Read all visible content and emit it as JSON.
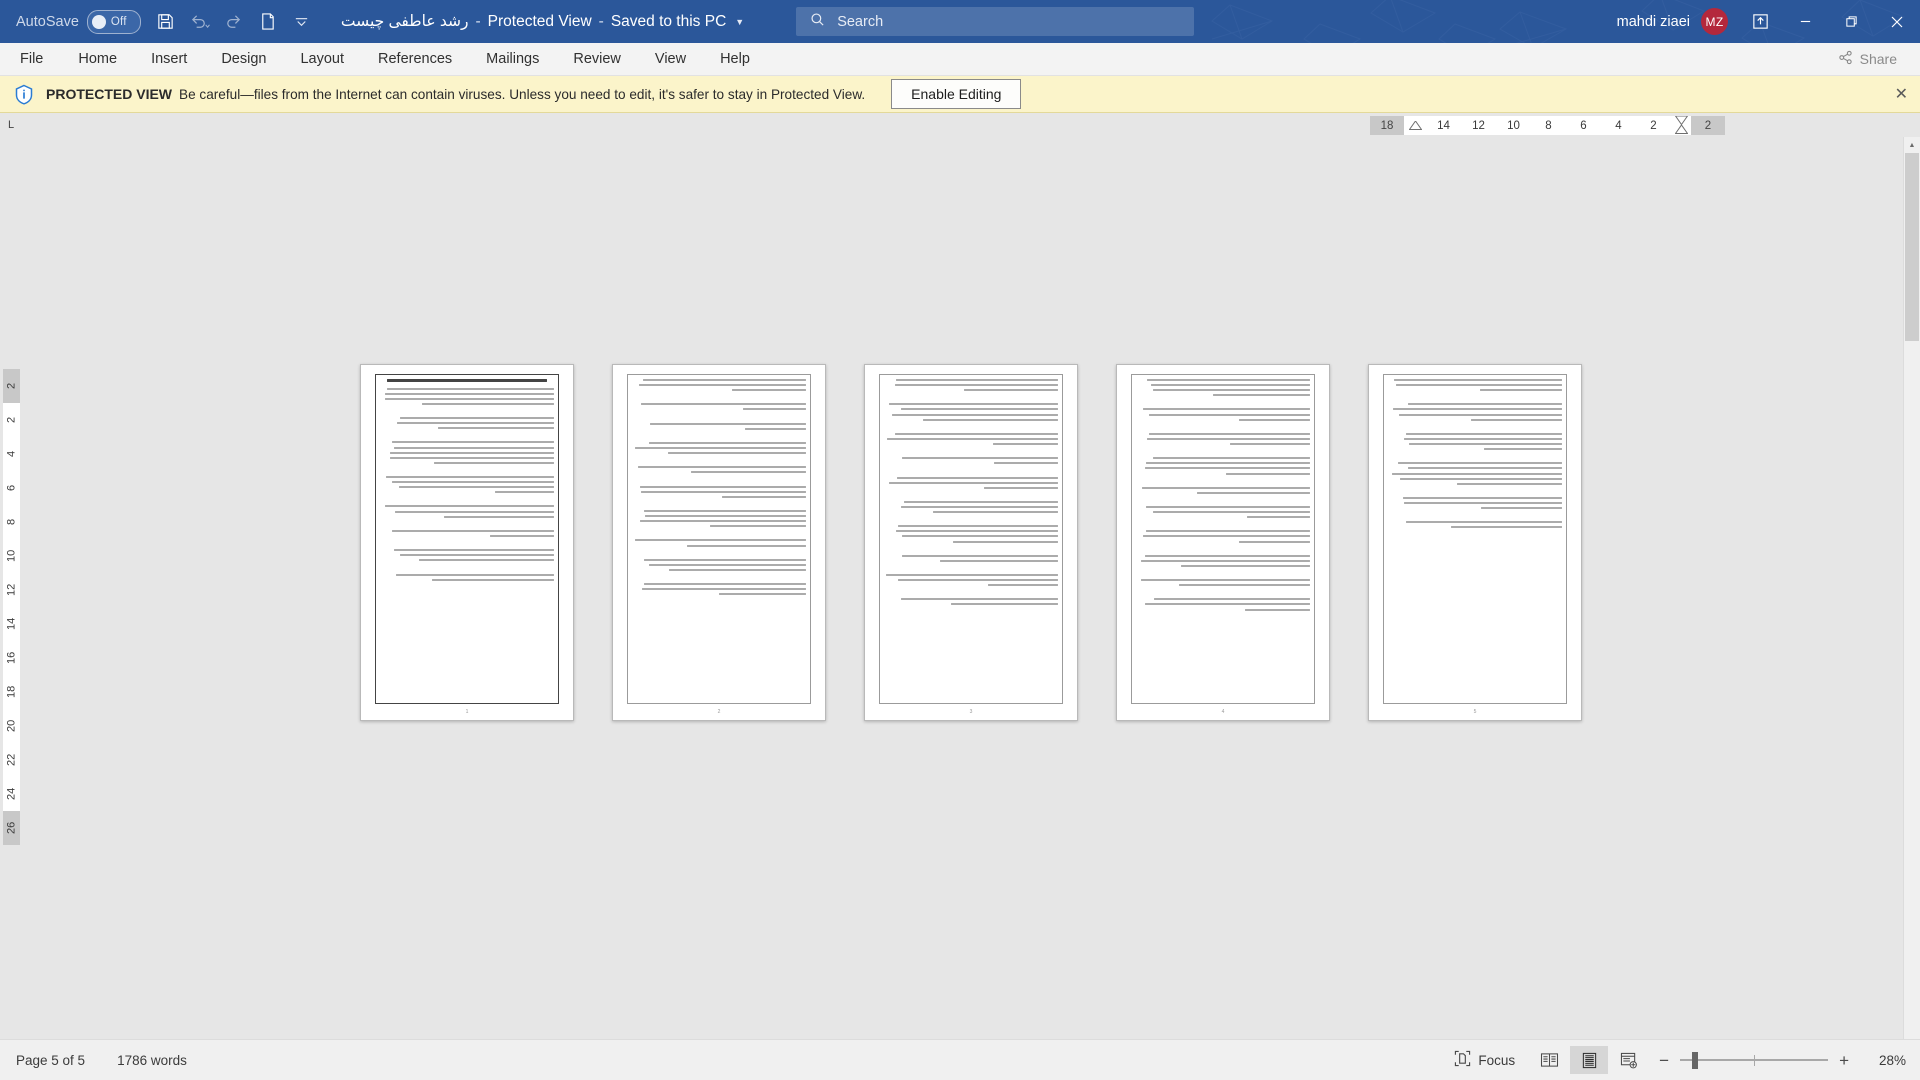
{
  "titlebar": {
    "autosave_label": "AutoSave",
    "autosave_state": "Off",
    "quick_access": [
      {
        "name": "save-icon",
        "label": "Save"
      },
      {
        "name": "undo-icon",
        "label": "Undo"
      },
      {
        "name": "redo-icon",
        "label": "Redo"
      },
      {
        "name": "new-document-icon",
        "label": "New"
      },
      {
        "name": "customize-quick-access-icon",
        "label": "Customize Quick Access Toolbar"
      }
    ],
    "document_title": "رشد عاطفی چیست",
    "protected_view_tag": "Protected View",
    "save_state": "Saved to this PC",
    "title_dropdown_icon": "chevron-down-icon",
    "search_placeholder": "Search",
    "search_icon": "search-icon",
    "account_name": "mahdi ziaei",
    "account_initials": "MZ",
    "ribbon_display_icon": "ribbon-display-options-icon",
    "minimize_icon": "minimize-icon",
    "restore_icon": "restore-icon",
    "close_icon": "close-icon",
    "bg_color": "#2b579a",
    "avatar_color": "#b4283c"
  },
  "ribbon": {
    "tabs": [
      {
        "label": "File"
      },
      {
        "label": "Home"
      },
      {
        "label": "Insert"
      },
      {
        "label": "Design"
      },
      {
        "label": "Layout"
      },
      {
        "label": "References"
      },
      {
        "label": "Mailings"
      },
      {
        "label": "Review"
      },
      {
        "label": "View"
      },
      {
        "label": "Help"
      }
    ],
    "share_label": "Share",
    "share_icon": "share-icon"
  },
  "protected_view": {
    "icon": "shield-info-icon",
    "title": "PROTECTED VIEW",
    "message": "Be careful—files from the Internet can contain viruses. Unless you need to edit, it's safer to stay in Protected View.",
    "button_label": "Enable Editing",
    "close_icon": "close-icon",
    "bg_color": "#fbf4ca"
  },
  "ruler": {
    "tab_stop_marker": "L",
    "horizontal_numbers": [
      "18",
      "14",
      "12",
      "10",
      "8",
      "6",
      "4",
      "2",
      "2"
    ],
    "vertical_top_number": "2",
    "vertical_numbers": [
      "2",
      "4",
      "6",
      "8",
      "10",
      "12",
      "14",
      "16",
      "18",
      "20",
      "22",
      "24",
      "26"
    ]
  },
  "document": {
    "page_count": 5,
    "pages": [
      {
        "number": "1",
        "heading_lines": 1,
        "body_blocks": [
          4,
          3,
          5,
          4,
          3,
          2,
          3,
          2
        ]
      },
      {
        "number": "2",
        "heading_lines": 0,
        "body_blocks": [
          3,
          2,
          2,
          3,
          2,
          3,
          4,
          2,
          3,
          3
        ]
      },
      {
        "number": "3",
        "heading_lines": 0,
        "body_blocks": [
          3,
          4,
          3,
          2,
          3,
          3,
          4,
          2,
          3,
          2
        ]
      },
      {
        "number": "4",
        "heading_lines": 0,
        "body_blocks": [
          4,
          3,
          3,
          4,
          2,
          3,
          3,
          3,
          2,
          3
        ]
      },
      {
        "number": "5",
        "heading_lines": 0,
        "body_blocks": [
          3,
          4,
          4,
          5,
          3,
          2
        ]
      }
    ]
  },
  "status": {
    "page_indicator": "Page 5 of 5",
    "word_count": "1786 words",
    "focus_label": "Focus",
    "focus_icon": "focus-mode-icon",
    "view_buttons": [
      {
        "name": "read-mode-icon",
        "label": "Read Mode",
        "active": false
      },
      {
        "name": "print-layout-icon",
        "label": "Print Layout",
        "active": true
      },
      {
        "name": "web-layout-icon",
        "label": "Web Layout",
        "active": false
      }
    ],
    "zoom_out_icon": "minus-icon",
    "zoom_in_icon": "plus-icon",
    "zoom_percent": "28%"
  }
}
